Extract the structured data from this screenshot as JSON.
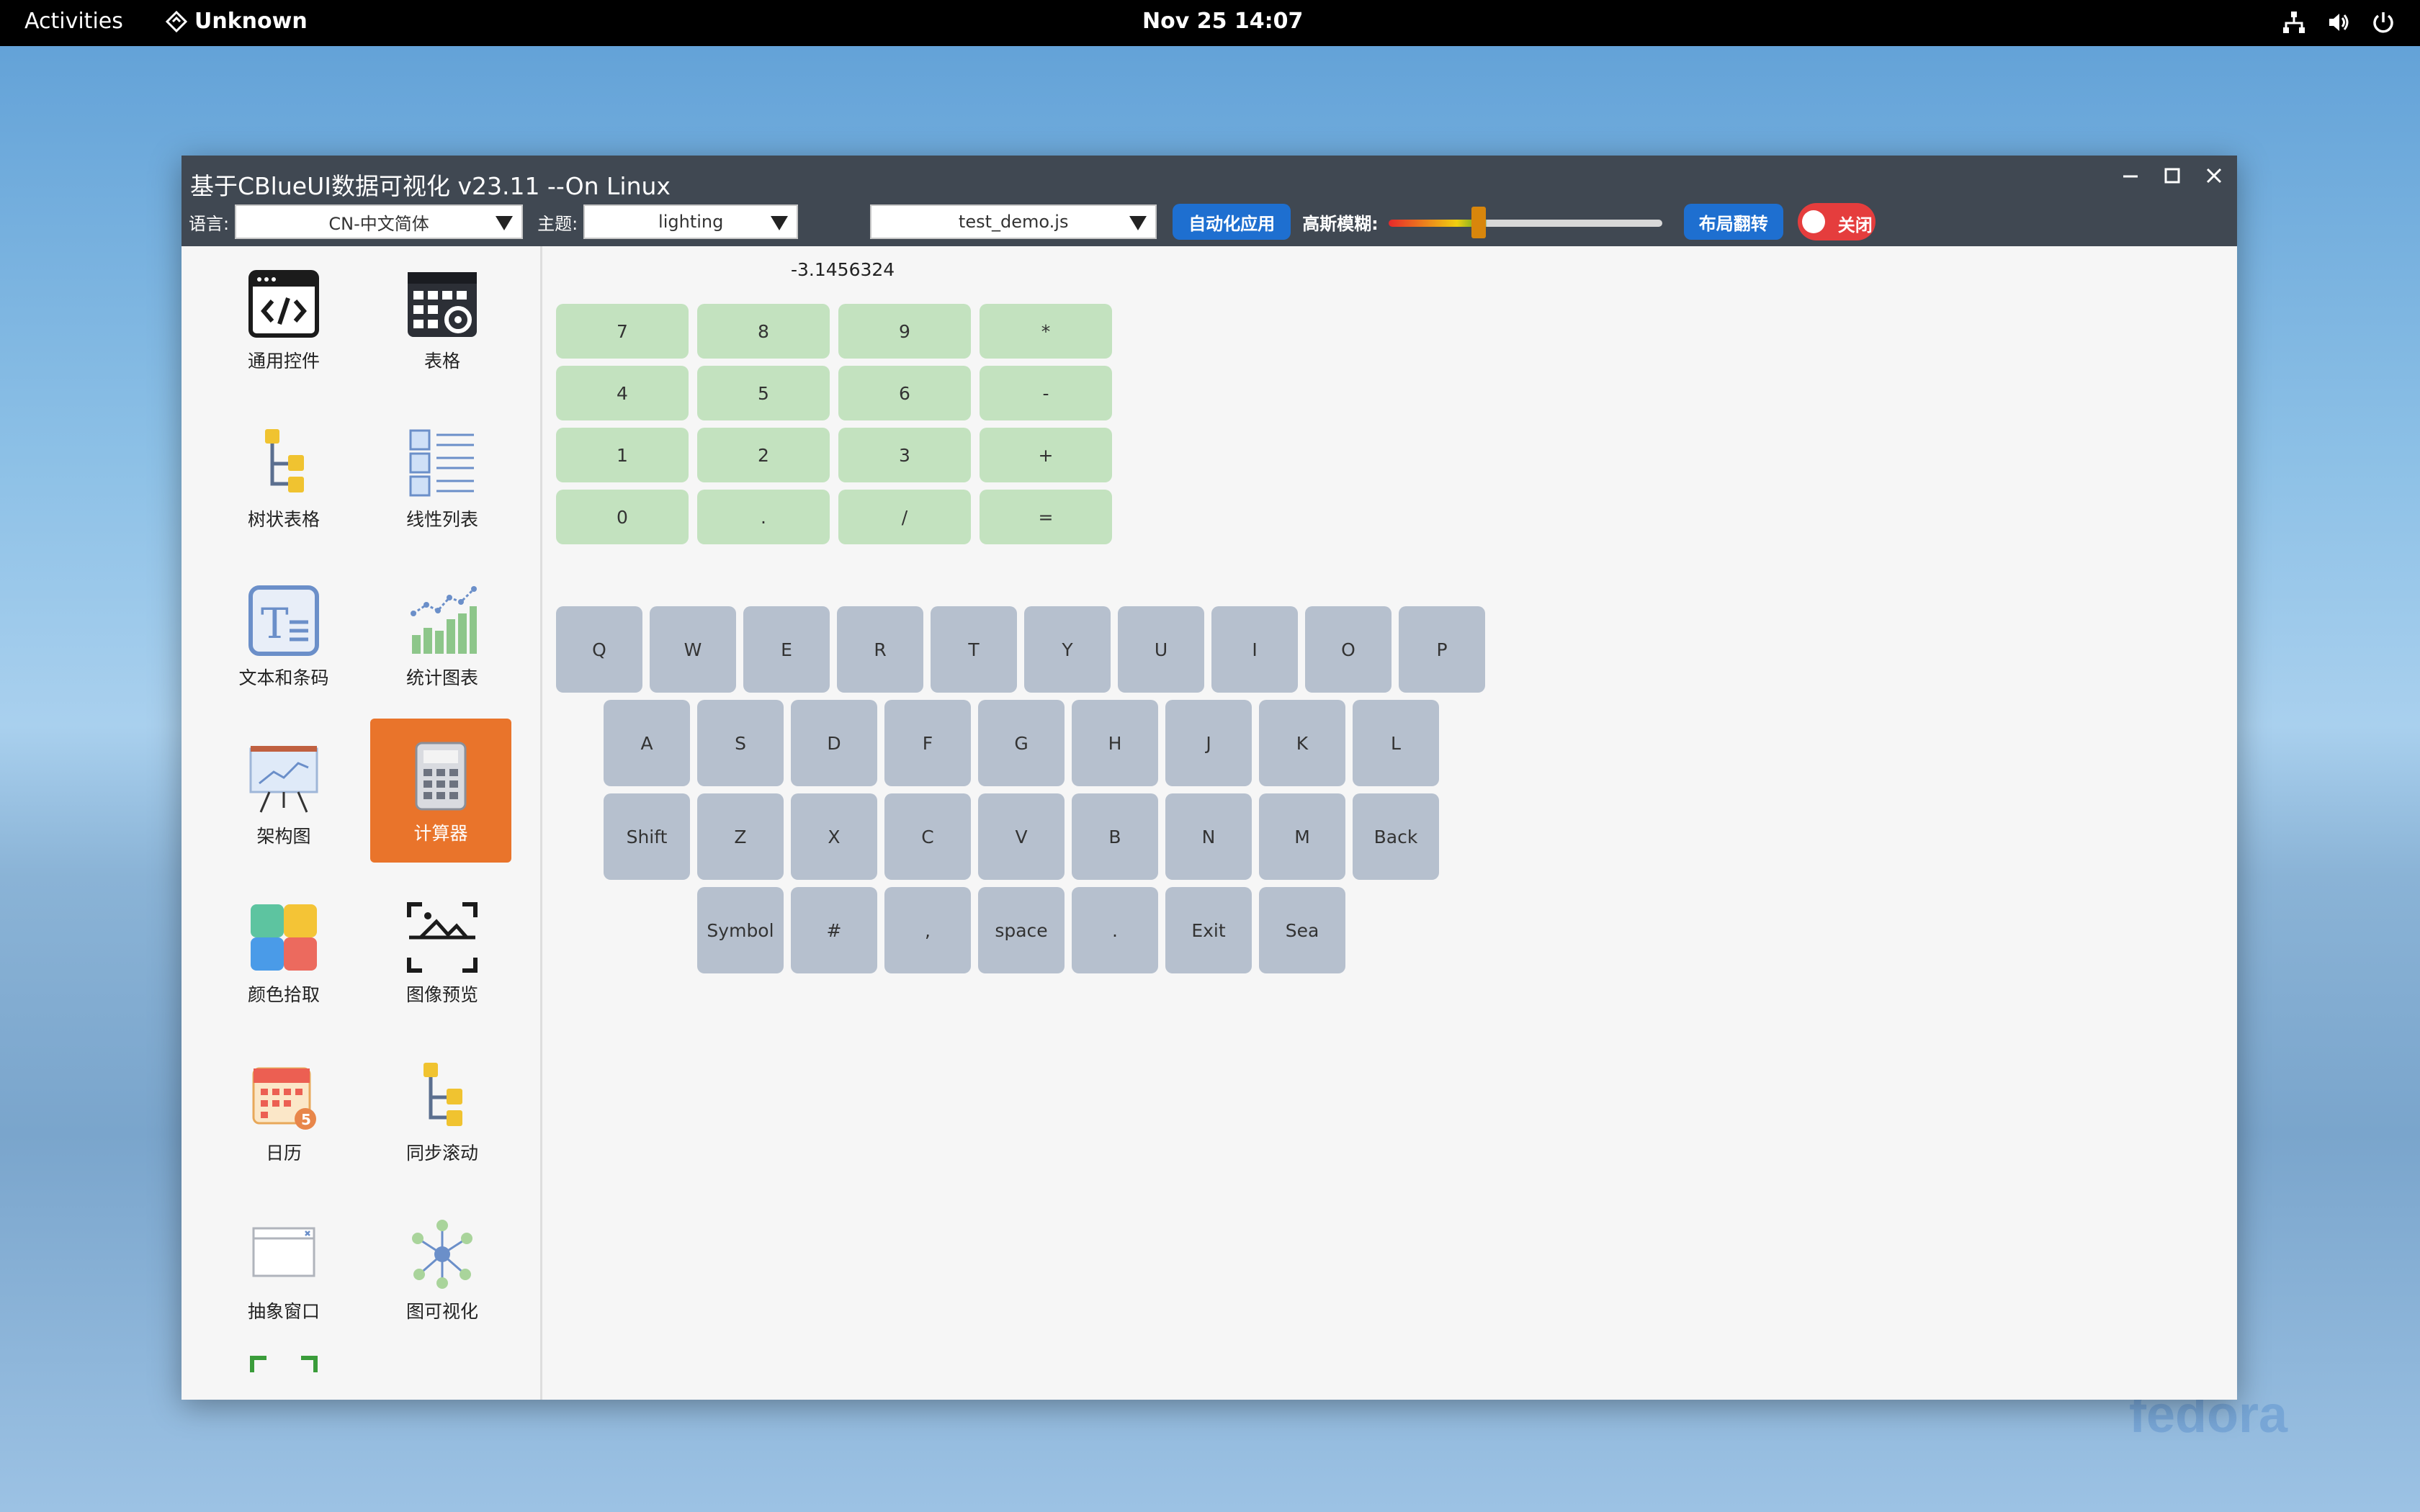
{
  "topbar": {
    "activities": "Activities",
    "app_name": "Unknown",
    "clock": "Nov 25  14:07"
  },
  "watermark": "fedora",
  "window": {
    "title": "基于CBlueUI数据可视化 v23.11 --On Linux",
    "toolbar": {
      "language_label": "语言:",
      "language_value": "CN-中文简体",
      "theme_label": "主题:",
      "theme_value": "lighting",
      "script_value": "test_demo.js",
      "auto_apply": "自动化应用",
      "blur_label": "高斯模糊:",
      "blur_level": 0.32,
      "layout_flip": "布局翻转",
      "toggle_label": "关闭"
    }
  },
  "sidebar": {
    "items": [
      {
        "label": "通用控件",
        "icon": "code-window-icon"
      },
      {
        "label": "表格",
        "icon": "table-settings-icon"
      },
      {
        "label": "树状表格",
        "icon": "tree-table-icon"
      },
      {
        "label": "线性列表",
        "icon": "linear-list-icon"
      },
      {
        "label": "文本和条码",
        "icon": "text-barcode-icon"
      },
      {
        "label": "统计图表",
        "icon": "stat-chart-icon"
      },
      {
        "label": "架构图",
        "icon": "architecture-board-icon"
      },
      {
        "label": "计算器",
        "icon": "calculator-icon"
      },
      {
        "label": "颜色拾取",
        "icon": "color-picker-icon"
      },
      {
        "label": "图像预览",
        "icon": "image-preview-icon"
      },
      {
        "label": "日历",
        "icon": "calendar-icon"
      },
      {
        "label": "同步滚动",
        "icon": "sync-scroll-icon"
      },
      {
        "label": "抽象窗口",
        "icon": "abstract-window-icon"
      },
      {
        "label": "图可视化",
        "icon": "graph-visual-icon"
      }
    ],
    "active": "计算器"
  },
  "calculator": {
    "display": "-3.1456324",
    "keys": [
      "7",
      "8",
      "9",
      "*",
      "4",
      "5",
      "6",
      "-",
      "1",
      "2",
      "3",
      "+",
      "0",
      ".",
      "/",
      "="
    ]
  },
  "keyboard": {
    "row1": [
      "Q",
      "W",
      "E",
      "R",
      "T",
      "Y",
      "U",
      "I",
      "O",
      "P"
    ],
    "row2": [
      "A",
      "S",
      "D",
      "F",
      "G",
      "H",
      "J",
      "K",
      "L"
    ],
    "row3": [
      "Shift",
      "Z",
      "X",
      "C",
      "V",
      "B",
      "N",
      "M",
      "Back"
    ],
    "row4": [
      "Symbol",
      "#",
      ",",
      "space",
      ".",
      "Exit",
      "Sea"
    ]
  },
  "colors": {
    "titlebar": "#404852",
    "active_nav": "#e9742b",
    "calc_key": "#c3e2bf",
    "kbd_key": "#b6c0ce",
    "blue_button": "#1e6fd0",
    "toggle_off": "#e53d3d"
  }
}
